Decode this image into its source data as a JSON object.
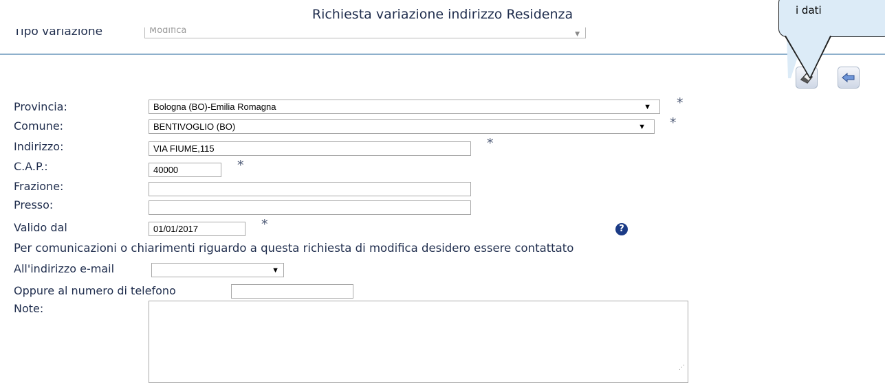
{
  "page": {
    "title": "Richiesta variazione indirizzo Residenza"
  },
  "tipo_variazione": {
    "label": "Tipo variazione",
    "value": "Modifica"
  },
  "callout": {
    "text": "i dati"
  },
  "toolbar": {
    "save_icon": "eraser-save-icon",
    "back_icon": "back-arrow-icon"
  },
  "form": {
    "provincia": {
      "label": "Provincia:",
      "value": "Bologna (BO)-Emilia Romagna"
    },
    "comune": {
      "label": "Comune:",
      "value": "BENTIVOGLIO (BO)"
    },
    "indirizzo": {
      "label": "Indirizzo:",
      "value": "VIA FIUME,115"
    },
    "cap": {
      "label": "C.A.P.:",
      "value": "40000"
    },
    "frazione": {
      "label": "Frazione:",
      "value": ""
    },
    "presso": {
      "label": "Presso:",
      "value": ""
    },
    "valido_dal": {
      "label": "Valido dal",
      "value": "01/01/2017"
    },
    "required_marker": "*",
    "help_symbol": "?",
    "contact_text": "Per comunicazioni o chiarimenti riguardo a questa richiesta di modifica desidero essere contattato",
    "email": {
      "label": "All'indirizzo e-mail",
      "value": ""
    },
    "telefono": {
      "label": "Oppure al numero di telefono",
      "value": ""
    },
    "note": {
      "label": "Note:",
      "value": ""
    }
  },
  "colors": {
    "label_text": "#1f2d4d",
    "divider": "#8eb0cc",
    "callout_bg": "#dcebf7",
    "help_icon": "#1b3b86"
  }
}
